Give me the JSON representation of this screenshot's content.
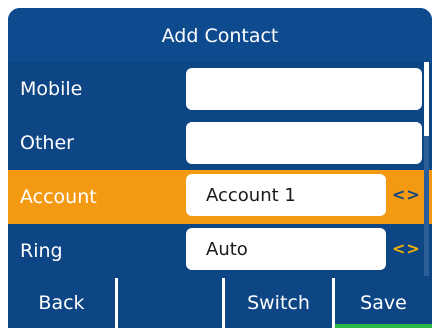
{
  "title": "Add Contact",
  "rows": [
    {
      "label": "Mobile",
      "value": ""
    },
    {
      "label": "Other",
      "value": ""
    },
    {
      "label": "Account",
      "value": "Account 1",
      "arrows": "<>"
    },
    {
      "label": "Ring",
      "value": "Auto",
      "arrows": "<>"
    }
  ],
  "softkeys": [
    "Back",
    "",
    "Switch",
    "Save"
  ],
  "colors": {
    "background": "#0d4585",
    "highlight": "#f39a12",
    "arrow_on_blue": "#f5b300",
    "save_indicator": "#2db84a"
  },
  "scroll_position": 0
}
